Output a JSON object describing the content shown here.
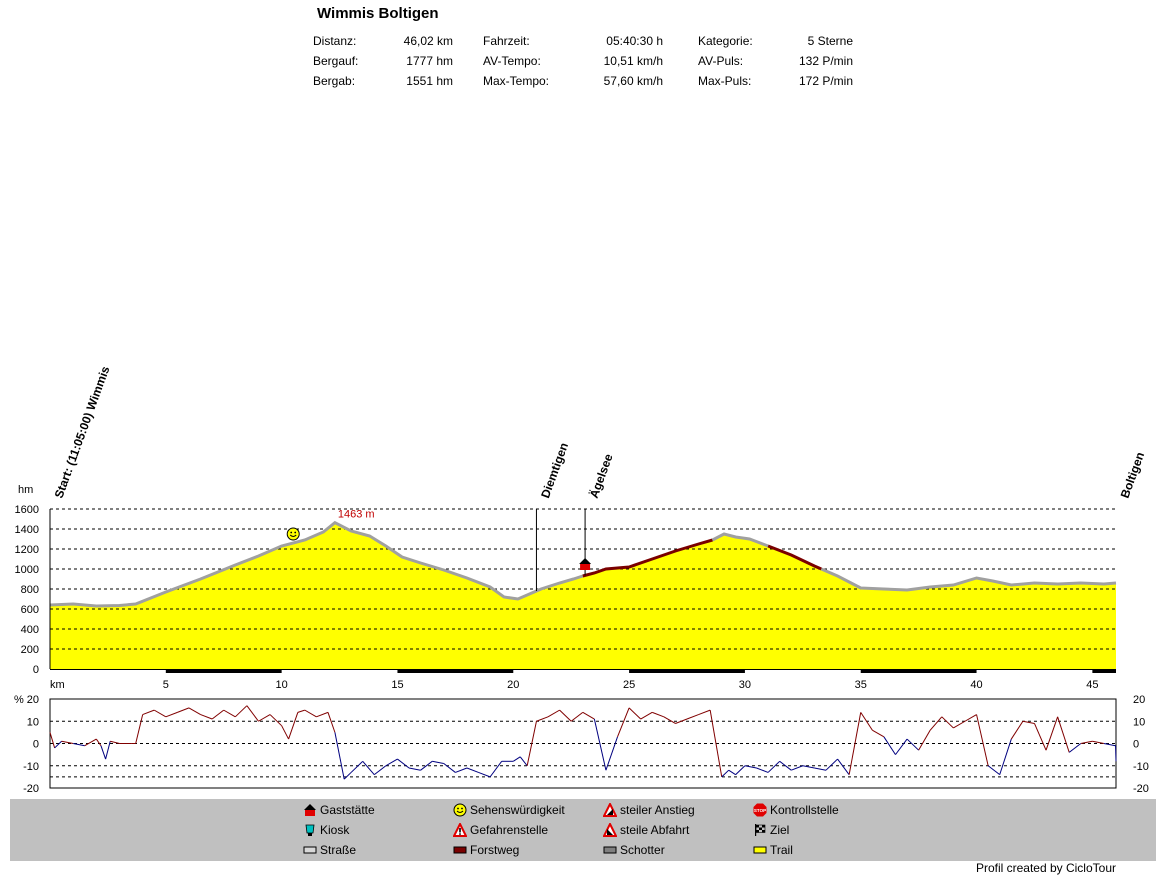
{
  "title": "Wimmis Boltigen",
  "stats": [
    [
      {
        "label": "Distanz:",
        "value": "46,02 km"
      },
      {
        "label": "Bergauf:",
        "value": "1777 hm"
      },
      {
        "label": "Bergab:",
        "value": "1551 hm"
      }
    ],
    [
      {
        "label": "Fahrzeit:",
        "value": "05:40:30 h"
      },
      {
        "label": "AV-Tempo:",
        "value": "10,51 km/h"
      },
      {
        "label": "Max-Tempo:",
        "value": "57,60 km/h"
      }
    ],
    [
      {
        "label": "Kategorie:",
        "value": "5 Sterne"
      },
      {
        "label": "AV-Puls:",
        "value": "132 P/min"
      },
      {
        "label": "Max-Puls:",
        "value": "172 P/min"
      }
    ]
  ],
  "colors": {
    "fill": "#ffff00",
    "road": "#a0a0a0",
    "forest": "#7a0000",
    "gradient_up": "#800000",
    "gradient_down": "#000080",
    "legend_bg": "#c0c0c0",
    "peak_label": "#c00000"
  },
  "chart_data": [
    {
      "type": "area",
      "ylabel": "hm",
      "xlabel": "km",
      "xlim": [
        0,
        46.02
      ],
      "ylim": [
        0,
        1600
      ],
      "y_ticks": [
        "0",
        "200",
        "400",
        "600",
        "800",
        "1000",
        "1200",
        "1400",
        "1600"
      ],
      "x_ticks": [
        "5",
        "10",
        "15",
        "20",
        "25",
        "30",
        "35",
        "40",
        "45"
      ],
      "grid": true,
      "x": [
        0,
        1,
        2,
        3,
        3.7,
        5,
        6.5,
        8,
        9,
        10,
        11,
        11.8,
        12.3,
        13,
        13.8,
        14.5,
        15.2,
        16,
        17,
        18,
        19,
        19.6,
        20.2,
        20.8,
        21.2,
        22,
        22.6,
        23,
        23.5,
        24,
        25,
        26,
        27,
        28,
        28.6,
        29.1,
        29.6,
        30.2,
        31,
        32,
        33,
        34,
        35,
        36,
        37,
        38,
        39,
        40,
        40.7,
        41.5,
        42.5,
        43.5,
        44.5,
        45.5,
        46.02
      ],
      "elevation": [
        640,
        650,
        630,
        635,
        650,
        770,
        900,
        1040,
        1130,
        1230,
        1290,
        1370,
        1463,
        1380,
        1330,
        1230,
        1120,
        1060,
        990,
        910,
        820,
        720,
        700,
        760,
        800,
        860,
        900,
        930,
        960,
        1000,
        1020,
        1100,
        1180,
        1250,
        1290,
        1350,
        1320,
        1300,
        1230,
        1140,
        1030,
        930,
        810,
        800,
        790,
        820,
        840,
        910,
        880,
        840,
        860,
        850,
        860,
        850,
        860
      ],
      "surface_segments": [
        {
          "from": 0,
          "to": 23,
          "type": "Straße"
        },
        {
          "from": 23,
          "to": 28.6,
          "type": "Forstweg"
        },
        {
          "from": 28.6,
          "to": 31,
          "type": "Straße"
        },
        {
          "from": 31,
          "to": 33.3,
          "type": "Forstweg"
        },
        {
          "from": 33.3,
          "to": 46.02,
          "type": "Straße"
        }
      ],
      "peak": {
        "x": 12.3,
        "label": "1463 m"
      },
      "waypoints": [
        {
          "x": 0,
          "label": "Start: (11:05:00) Wimmis"
        },
        {
          "x": 21,
          "label": "Diemtigen"
        },
        {
          "x": 23.1,
          "label": "Ägelsee"
        },
        {
          "x": 46.02,
          "label": "Boltigen"
        }
      ],
      "markers": [
        {
          "x": 10.5,
          "elevation": 1350,
          "icon": "Sehenswürdigkeit"
        },
        {
          "x": 23.1,
          "elevation": 1020,
          "icon": "Gaststätte"
        }
      ]
    },
    {
      "type": "line",
      "ylabel": "%",
      "ylim": [
        -20,
        20
      ],
      "y_ticks": [
        "20",
        "10",
        "0",
        "-10",
        "-20"
      ],
      "grid": true,
      "x": [
        0,
        0.2,
        0.5,
        1,
        1.5,
        2,
        2.2,
        2.4,
        2.6,
        3,
        3.5,
        3.7,
        4,
        4.5,
        5,
        5.5,
        6,
        6.5,
        7,
        7.5,
        8,
        8.5,
        9,
        9.5,
        10,
        10.3,
        10.7,
        11,
        11.5,
        12,
        12.3,
        12.7,
        13,
        13.5,
        14,
        14.5,
        15,
        15.5,
        16,
        16.5,
        17,
        17.5,
        18,
        18.5,
        19,
        19.5,
        20,
        20.3,
        20.6,
        21,
        21.5,
        22,
        22.5,
        23,
        23.5,
        24,
        24.5,
        25,
        25.5,
        26,
        26.5,
        27,
        27.5,
        28,
        28.5,
        29,
        29.3,
        29.6,
        30,
        30.5,
        31,
        31.5,
        32,
        32.5,
        33,
        33.5,
        34,
        34.5,
        35,
        35.5,
        36,
        36.5,
        37,
        37.5,
        38,
        38.5,
        39,
        39.5,
        40,
        40.5,
        41,
        41.5,
        42,
        42.5,
        43,
        43.5,
        44,
        44.5,
        45,
        45.5,
        46,
        46.02
      ],
      "gradient": [
        5,
        -2,
        1,
        0,
        -1,
        2,
        -1,
        -7,
        1,
        0,
        0,
        0,
        13,
        15,
        12,
        14,
        16,
        13,
        11,
        15,
        12,
        17,
        10,
        13,
        8,
        2,
        14,
        15,
        12,
        14,
        5,
        -16,
        -13,
        -8,
        -14,
        -10,
        -7,
        -11,
        -12,
        -8,
        -9,
        -13,
        -11,
        -13,
        -15,
        -8,
        -8,
        -6,
        -10,
        10,
        12,
        15,
        10,
        14,
        11,
        -12,
        3,
        16,
        11,
        14,
        12,
        9,
        11,
        13,
        15,
        -15,
        -12,
        -14,
        -10,
        -11,
        -13,
        -8,
        -12,
        -10,
        -11,
        -12,
        -7,
        -14,
        14,
        6,
        3,
        -5,
        2,
        -3,
        6,
        12,
        7,
        10,
        13,
        -10,
        -14,
        2,
        10,
        9,
        -3,
        12,
        -4,
        0,
        1,
        0,
        -1,
        -8
      ]
    }
  ],
  "legend": [
    {
      "icon": "Gaststätte",
      "label": "Gaststätte"
    },
    {
      "icon": "Sehenswürdigkeit",
      "label": "Sehenswürdigkeit"
    },
    {
      "icon": "steiler Anstieg",
      "label": "steiler Anstieg"
    },
    {
      "icon": "Kontrollstelle",
      "label": "Kontrollstelle"
    },
    {
      "icon": "Kiosk",
      "label": "Kiosk"
    },
    {
      "icon": "Gefahrenstelle",
      "label": "Gefahrenstelle"
    },
    {
      "icon": "steile Abfahrt",
      "label": "steile Abfahrt"
    },
    {
      "icon": "Ziel",
      "label": "Ziel"
    },
    {
      "icon": "Straße",
      "label": "Straße"
    },
    {
      "icon": "Forstweg",
      "label": "Forstweg"
    },
    {
      "icon": "Schotter",
      "label": "Schotter"
    },
    {
      "icon": "Trail",
      "label": "Trail"
    }
  ],
  "credit": "Profil created by CicloTour"
}
